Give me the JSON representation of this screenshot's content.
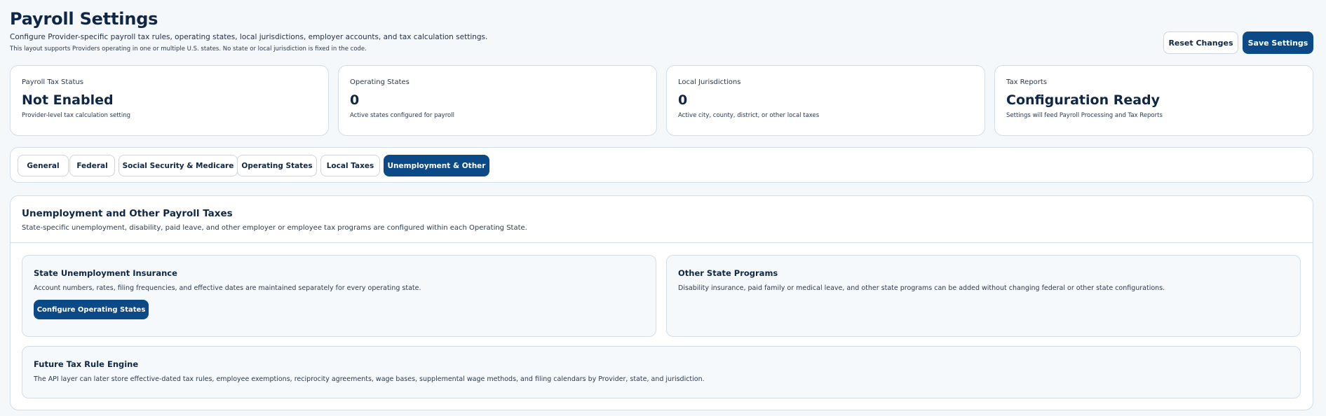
{
  "header": {
    "title": "Payroll Settings",
    "subtitle": "Configure Provider-specific payroll tax rules, operating states, local jurisdictions, employer accounts, and tax calculation settings.",
    "note": "This layout supports Providers operating in one or multiple U.S. states. No state or local jurisdiction is fixed in the code.",
    "reset_label": "Reset Changes",
    "save_label": "Save Settings"
  },
  "stats": [
    {
      "label": "Payroll Tax Status",
      "value": "Not Enabled",
      "desc": "Provider-level tax calculation setting"
    },
    {
      "label": "Operating States",
      "value": "0",
      "desc": "Active states configured for payroll"
    },
    {
      "label": "Local Jurisdictions",
      "value": "0",
      "desc": "Active city, county, district, or other local taxes"
    },
    {
      "label": "Tax Reports",
      "value": "Configuration Ready",
      "desc": "Settings will feed Payroll Processing and Tax Reports"
    }
  ],
  "tabs": [
    {
      "label": "General"
    },
    {
      "label": "Federal"
    },
    {
      "label": "Social Security & Medicare"
    },
    {
      "label": "Operating States"
    },
    {
      "label": "Local Taxes"
    },
    {
      "label": "Unemployment & Other"
    }
  ],
  "active_tab": "Unemployment & Other",
  "section": {
    "title": "Unemployment and Other Payroll Taxes",
    "desc": "State-specific unemployment, disability, paid leave, and other employer or employee tax programs are configured within each Operating State.",
    "cards": {
      "sui": {
        "title": "State Unemployment Insurance",
        "desc": "Account numbers, rates, filing frequencies, and effective dates are maintained separately for every operating state.",
        "button": "Configure Operating States"
      },
      "other": {
        "title": "Other State Programs",
        "desc": "Disability insurance, paid family or medical leave, and other state programs can be added without changing federal or other state configurations."
      },
      "future": {
        "title": "Future Tax Rule Engine",
        "desc": "The API layer can later store effective-dated tax rules, employee exemptions, reciprocity agreements, wage bases, supplemental wage methods, and filing calendars by Provider, state, and jurisdiction."
      }
    }
  },
  "colors": {
    "primary": "#0b4a86",
    "text": "#0f2744",
    "background": "#f5f8fa",
    "border": "#d4dde6"
  }
}
